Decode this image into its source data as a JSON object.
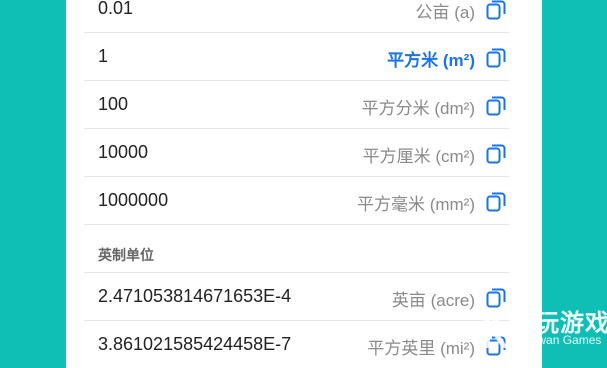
{
  "colors": {
    "background": "#0fbfb5",
    "accent": "#1a73e8",
    "text": "#222222",
    "muted": "#8a8a8a"
  },
  "metric_rows": [
    {
      "value": "0.01",
      "unit": "公亩 (a)",
      "active": false
    },
    {
      "value": "1",
      "unit": "平方米 (m²)",
      "active": true
    },
    {
      "value": "100",
      "unit": "平方分米 (dm²)",
      "active": false
    },
    {
      "value": "10000",
      "unit": "平方厘米 (cm²)",
      "active": false
    },
    {
      "value": "1000000",
      "unit": "平方毫米 (mm²)",
      "active": false
    }
  ],
  "imperial_section": {
    "title": "英制单位"
  },
  "imperial_rows": [
    {
      "value": "2.471053814671653E-4",
      "unit": "英亩 (acre)",
      "active": false
    },
    {
      "value": "3.861021585424458E-7",
      "unit": "平方英里 (mi²)",
      "active": false
    }
  ],
  "icons": {
    "copy": "copy-icon"
  },
  "watermark": {
    "title": "仿玩游戏",
    "subtitle": "Fangwan Games"
  }
}
